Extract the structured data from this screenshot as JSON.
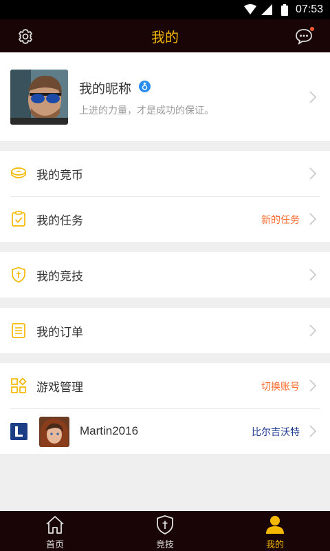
{
  "status_bar": {
    "time": "07:53"
  },
  "header": {
    "title": "我的",
    "settings_icon": "gear-icon",
    "message_icon": "chat-bubble-icon"
  },
  "profile": {
    "nickname": "我的昵称",
    "gender_icon": "male-icon",
    "motto": "上进的力量，才是成功的保证。"
  },
  "menu": {
    "coins": {
      "label": "我的竞币",
      "icon": "coin-icon"
    },
    "tasks": {
      "label": "我的任务",
      "aside": "新的任务",
      "icon": "clipboard-check-icon"
    },
    "competition": {
      "label": "我的竞技",
      "icon": "shield-sword-icon"
    },
    "orders": {
      "label": "我的订单",
      "icon": "list-document-icon"
    },
    "game_manage": {
      "label": "游戏管理",
      "aside": "切换账号",
      "icon": "grid-icon"
    },
    "account": {
      "name": "Martin2016",
      "server": "比尔吉沃特",
      "game_icon": "lol-icon"
    }
  },
  "tabs": [
    {
      "label": "首页",
      "icon": "home-icon"
    },
    {
      "label": "竞技",
      "icon": "shield-sword-icon"
    },
    {
      "label": "我的",
      "icon": "user-icon"
    }
  ],
  "colors": {
    "accent": "#f5b800",
    "orange_text": "#ff6a2a",
    "blue_text": "#1f3a93",
    "dark_bar": "#190505"
  }
}
